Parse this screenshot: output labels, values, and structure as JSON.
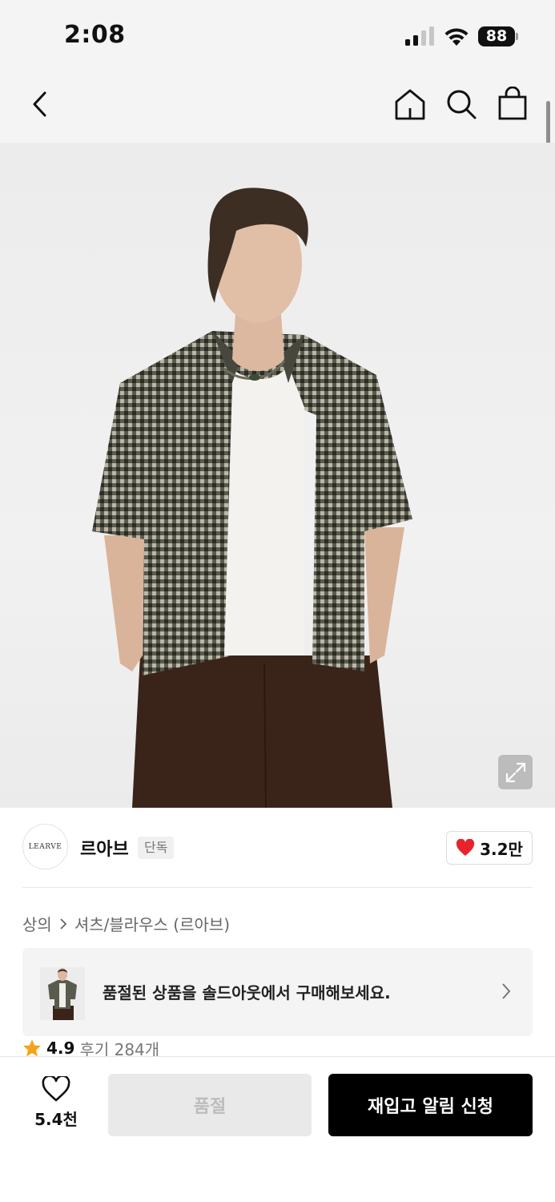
{
  "status_bar": {
    "time": "2:08",
    "battery_level": "88",
    "icons": [
      "signal-icon",
      "wifi-icon",
      "battery-icon"
    ]
  },
  "nav": {
    "icons": [
      "back-icon",
      "home-icon",
      "search-icon",
      "shopping-bag-icon"
    ]
  },
  "product": {
    "image_icon": "expand-icon",
    "brand": {
      "logo_text": "LEARVE",
      "name": "르아브",
      "tag": "단독",
      "likes": "3.2만",
      "likes_icon": "heart-filled-icon",
      "likes_color": "#e8232b"
    },
    "breadcrumb": [
      "상의",
      "셔츠/블라우스 (르아브)"
    ],
    "soldout_banner": {
      "text": "품절된 상품을 솔드아웃에서 구매해보세요."
    },
    "rating": {
      "score": "4.9",
      "reviews": "후기 284개",
      "star_color": "#f7a21b"
    }
  },
  "bottom_bar": {
    "wishlist_count": "5.4천",
    "soldout_label": "품절",
    "restock_label": "재입고 알림 신청"
  }
}
